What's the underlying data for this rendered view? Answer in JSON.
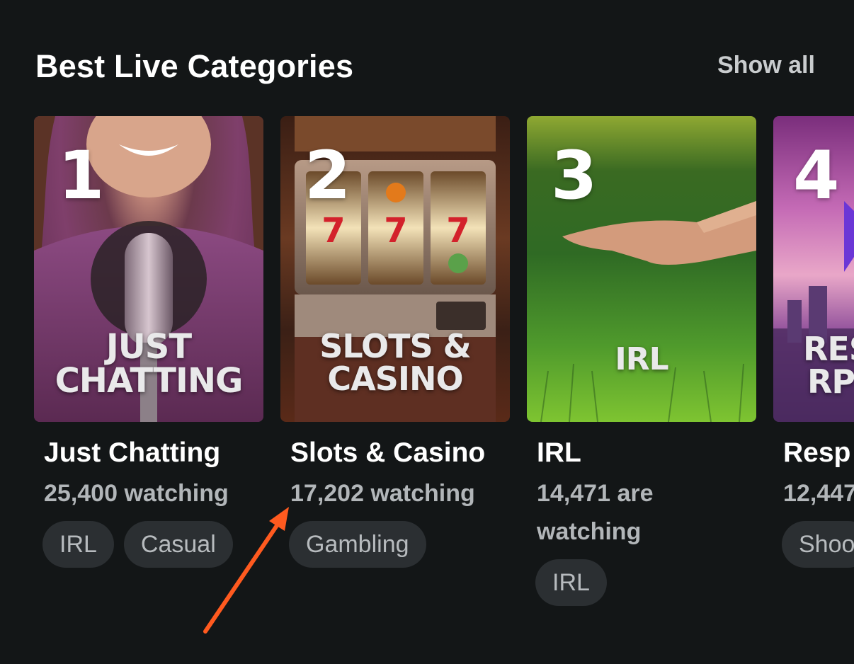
{
  "section": {
    "title": "Best Live Categories",
    "show_all_label": "Show all"
  },
  "categories": [
    {
      "rank": "1",
      "thumb_lines": [
        "JUST",
        "CHATTING"
      ],
      "name": "Just Chatting",
      "viewers": "25,400 watching",
      "tags": [
        "IRL",
        "Casual"
      ]
    },
    {
      "rank": "2",
      "thumb_lines": [
        "SLOTS &",
        "CASINO"
      ],
      "name": "Slots & Casino",
      "viewers": "17,202 watching",
      "tags": [
        "Gambling"
      ]
    },
    {
      "rank": "3",
      "thumb_lines": [
        "IRL"
      ],
      "name": "IRL",
      "viewers": "14,471 are watching",
      "tags": [
        "IRL"
      ]
    },
    {
      "rank": "4",
      "thumb_lines": [
        "RES",
        "RP"
      ],
      "name": "Resp",
      "viewers": "12,447",
      "tags": [
        "Shoo"
      ]
    }
  ],
  "colors": {
    "background": "#131617",
    "tag_background": "#2b2f32",
    "annotation_arrow": "#ff5a1f"
  }
}
